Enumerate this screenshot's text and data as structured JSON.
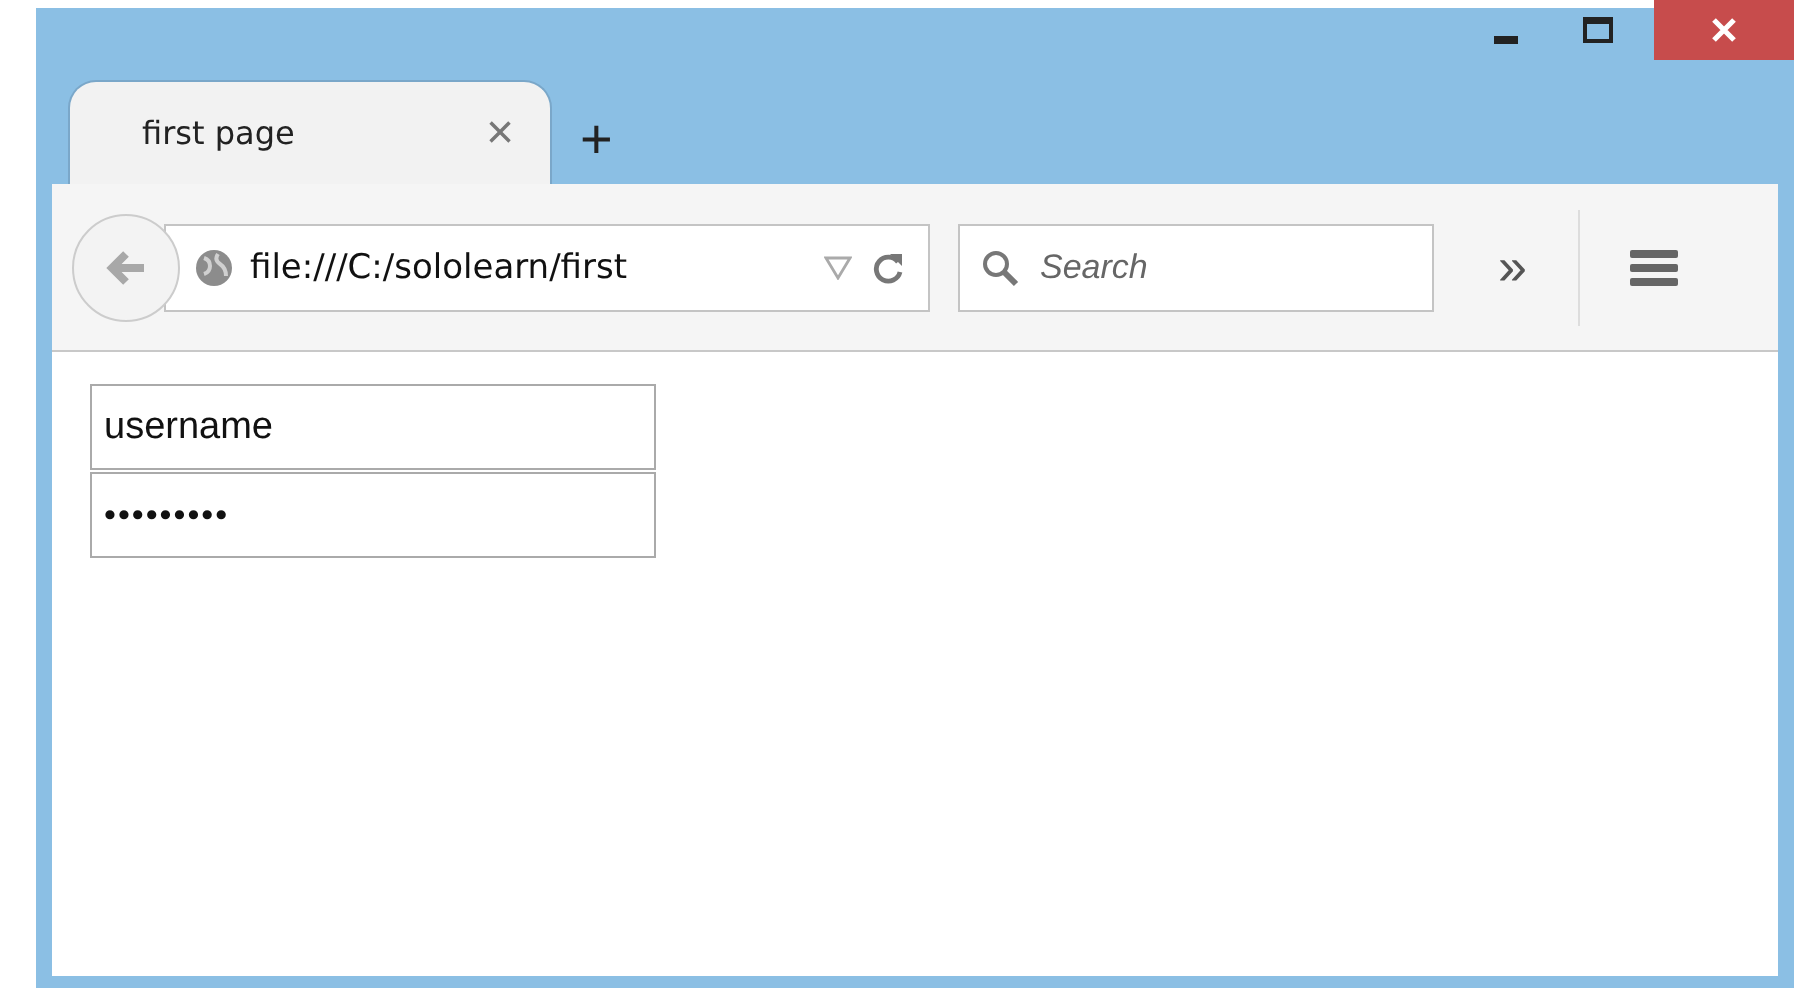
{
  "tabs": [
    {
      "label": "first page",
      "selected": true,
      "close": "×"
    }
  ],
  "new_tab": "+",
  "address_bar": {
    "value": "file:///C:/sololearn/first"
  },
  "search": {
    "placeholder": "Search"
  },
  "overflow": "»",
  "form": {
    "fields": [
      {
        "kind": "text",
        "value": "username"
      },
      {
        "kind": "password",
        "value": "•••••••••"
      }
    ]
  }
}
